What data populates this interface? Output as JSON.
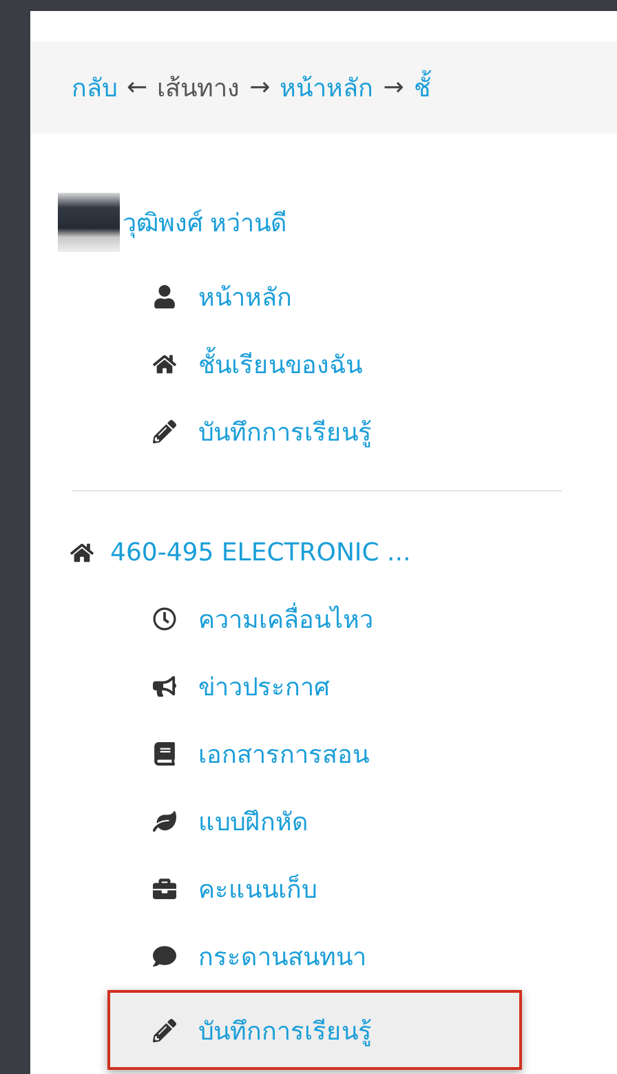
{
  "breadcrumb": [
    {
      "text": "กลับ",
      "kind": "link"
    },
    {
      "text": "←",
      "kind": "separator"
    },
    {
      "text": "เส้นทาง",
      "kind": "text"
    },
    {
      "text": "→",
      "kind": "separator"
    },
    {
      "text": "หน้าหลัก",
      "kind": "link"
    },
    {
      "text": "→",
      "kind": "separator"
    },
    {
      "text": "ชั้",
      "kind": "link"
    }
  ],
  "user": {
    "name": "วุฒิพงศ์ หว่านดี",
    "items": [
      {
        "label": "หน้าหลัก",
        "selected": false
      },
      {
        "label": "ชั้นเรียนของฉัน",
        "selected": false
      },
      {
        "label": "บันทึกการเรียนรู้",
        "selected": false
      }
    ]
  },
  "course": {
    "title": "460-495 ELECTRONIC ...",
    "items": [
      {
        "label": "ความเคลื่อนไหว",
        "selected": false
      },
      {
        "label": "ข่าวประกาศ",
        "selected": false
      },
      {
        "label": "เอกสารการสอน",
        "selected": false
      },
      {
        "label": "แบบฝึกหัด",
        "selected": false
      },
      {
        "label": "คะแนนเก็บ",
        "selected": false
      },
      {
        "label": "กระดานสนทนา",
        "selected": false
      },
      {
        "label": "บันทึกการเรียนรู้",
        "selected": true
      }
    ]
  }
}
